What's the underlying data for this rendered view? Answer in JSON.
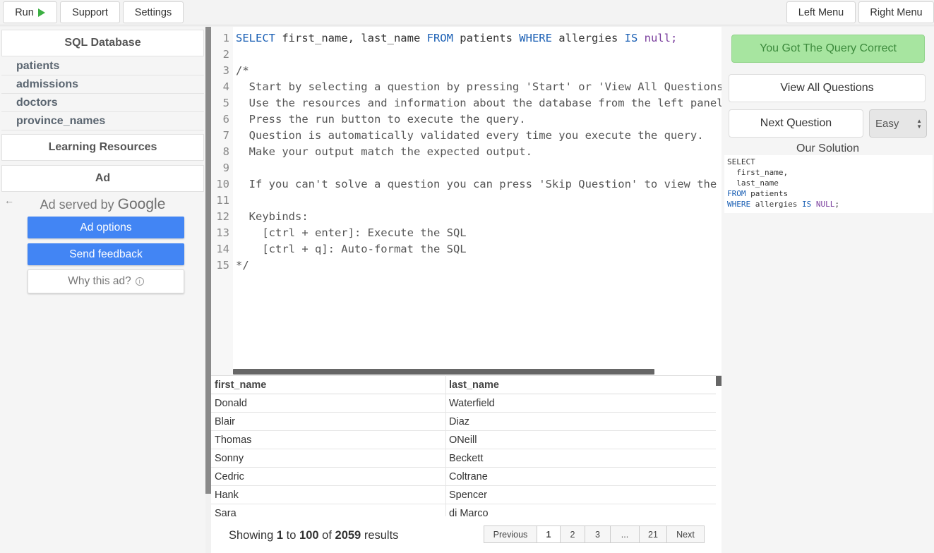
{
  "toolbar": {
    "run_label": "Run",
    "support_label": "Support",
    "settings_label": "Settings",
    "left_menu_label": "Left Menu",
    "right_menu_label": "Right Menu"
  },
  "sidebar": {
    "db_title": "SQL Database",
    "tables": [
      "patients",
      "admissions",
      "doctors",
      "province_names"
    ],
    "learning_title": "Learning Resources",
    "ad_title": "Ad",
    "ad_served": "Ad served by",
    "ad_brand": "Google",
    "ad_options": "Ad options",
    "send_feedback": "Send feedback",
    "why_ad": "Why this ad?"
  },
  "editor": {
    "line_numbers": [
      "1",
      "2",
      "3",
      "4",
      "5",
      "6",
      "7",
      "8",
      "9",
      "10",
      "11",
      "12",
      "13",
      "14",
      "15"
    ],
    "line1": {
      "kw1": "SELECT",
      "t1": " first_name, last_name ",
      "kw2": "FROM",
      "t2": " patients ",
      "kw3": "WHERE",
      "t3": " allergies ",
      "kw4": "IS",
      "t4": " null;"
    },
    "lines": [
      "",
      "/*",
      "  Start by selecting a question by pressing 'Start' or 'View All Questions'.",
      "  Use the resources and information about the database from the left panel",
      "  Press the run button to execute the query.",
      "  Question is automatically validated every time you execute the query.",
      "  Make your output match the expected output.",
      "",
      "  If you can't solve a question you can press 'Skip Question' to view the",
      "",
      "  Keybinds:",
      "    [ctrl + enter]: Execute the SQL",
      "    [ctrl + q]: Auto-format the SQL",
      "*/"
    ]
  },
  "results": {
    "columns": [
      "first_name",
      "last_name"
    ],
    "rows": [
      [
        "Donald",
        "Waterfield"
      ],
      [
        "Blair",
        "Diaz"
      ],
      [
        "Thomas",
        "ONeill"
      ],
      [
        "Sonny",
        "Beckett"
      ],
      [
        "Cedric",
        "Coltrane"
      ],
      [
        "Hank",
        "Spencer"
      ],
      [
        "Sara",
        "di Marco"
      ]
    ],
    "summary": {
      "prefix": "Showing",
      "from": "1",
      "to_word": "to",
      "to": "100",
      "of_word": "of",
      "total": "2059",
      "suffix": "results"
    },
    "pagination": [
      "Previous",
      "1",
      "2",
      "3",
      "...",
      "21",
      "Next"
    ]
  },
  "right": {
    "correct_label": "You Got The Query Correct",
    "view_all_label": "View All Questions",
    "next_label": "Next Question",
    "difficulty": "Easy",
    "solution_title": "Our Solution",
    "solution": {
      "l1": "SELECT",
      "l2": "  first_name,",
      "l3": "  last_name",
      "l4_kw": "FROM",
      "l4_t": " patients",
      "l5_kw1": "WHERE",
      "l5_t": " allergies ",
      "l5_kw2": "IS",
      "l5_kw3": " NULL",
      "l5_end": ";"
    }
  },
  "colors": {
    "accent": "#4285f4",
    "success_bg": "#a7e5a0",
    "run_icon": "#3cb043",
    "keyword": "#1a5fb4"
  }
}
